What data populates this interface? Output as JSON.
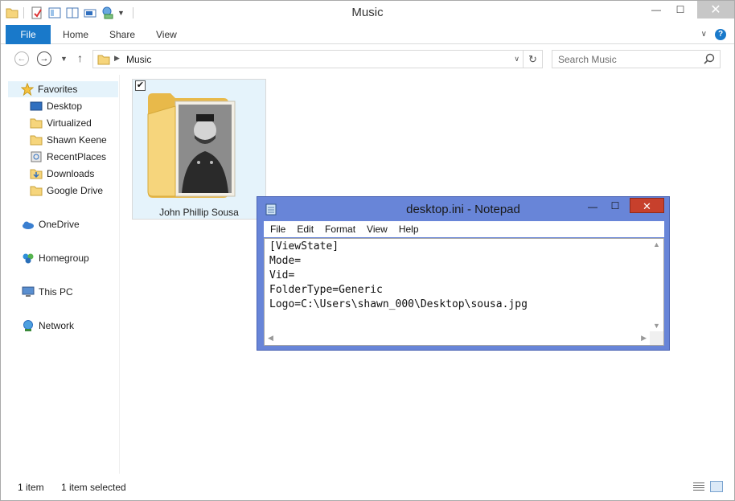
{
  "explorer": {
    "title": "Music",
    "controls": {
      "minimize": "—",
      "maximize": "☐",
      "close": "✕"
    },
    "ribbon": {
      "tabs": [
        "File",
        "Home",
        "Share",
        "View"
      ],
      "help": "?"
    },
    "address": {
      "path": "Music",
      "search_placeholder": "Search Music"
    },
    "nav": {
      "favorites_header": "Favorites",
      "favorites": [
        {
          "label": "Desktop",
          "icon": "desktop-icon"
        },
        {
          "label": "Virtualized",
          "icon": "folder-icon"
        },
        {
          "label": "Shawn Keene",
          "icon": "folder-icon"
        },
        {
          "label": "RecentPlaces",
          "icon": "recent-places-icon"
        },
        {
          "label": "Downloads",
          "icon": "downloads-icon"
        },
        {
          "label": "Google Drive",
          "icon": "folder-icon"
        }
      ],
      "onedrive": "OneDrive",
      "homegroup": "Homegroup",
      "thispc": "This PC",
      "network": "Network"
    },
    "content": {
      "folder_label": "John Phillip Sousa",
      "folder_checked": "✔"
    },
    "status": {
      "count": "1 item",
      "selected": "1 item selected"
    }
  },
  "notepad": {
    "title": "desktop.ini - Notepad",
    "controls": {
      "minimize": "—",
      "maximize": "☐",
      "close": "✕"
    },
    "menus": [
      "File",
      "Edit",
      "Format",
      "View",
      "Help"
    ],
    "text_lines": [
      "[ViewState]",
      "Mode=",
      "Vid=",
      "FolderType=Generic",
      "Logo=C:\\Users\\shawn_000\\Desktop\\sousa.jpg"
    ]
  },
  "colors": {
    "accent": "#1979ca",
    "folder": "#f6d57c",
    "notepad_frame": "#6885d8",
    "close_red": "#c7402c",
    "selection": "#e5f3fb"
  }
}
